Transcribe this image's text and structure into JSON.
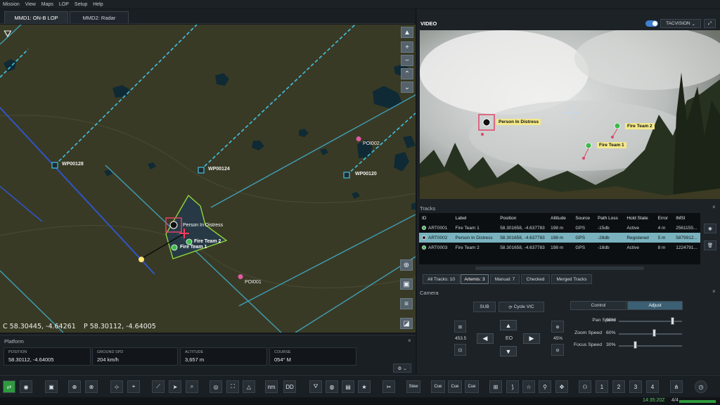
{
  "menu": [
    "Mission",
    "View",
    "Maps",
    "LOP",
    "Setup",
    "Help"
  ],
  "tabs": [
    {
      "label": "MMD1: ON-B LOP",
      "active": true
    },
    {
      "label": "MMD2: Radar",
      "active": false
    }
  ],
  "map": {
    "waypoints": [
      "WP00128",
      "WP00124",
      "WP00120"
    ],
    "pois": [
      "POI002",
      "POI001"
    ],
    "targets": [
      "Person In Distress",
      "Fire Team 2",
      "Fire Team 1"
    ],
    "cursor_coord": "C 58.30445, -4.64261",
    "platform_coord": "P 58.30112, -4.64005"
  },
  "platform": {
    "title": "Platform",
    "fields": [
      {
        "label": "POSITION",
        "value": "58.30112, -4.64005"
      },
      {
        "label": "GROUND SPD",
        "value": "204 km/h"
      },
      {
        "label": "ALTITUDE",
        "value": "3,657 m"
      },
      {
        "label": "COURSE",
        "value": "054° M"
      }
    ]
  },
  "video": {
    "title": "VIDEO",
    "source": "TACVISION",
    "labels": {
      "pid": "Person In Distress",
      "ft2": "Fire Team 2",
      "ft1": "Fire Team 1"
    }
  },
  "tracks": {
    "title": "Tracks",
    "columns": [
      "ID",
      "Label",
      "Position",
      "Altitude",
      "Source",
      "Path Loss",
      "Hold State",
      "Error",
      "IMSI"
    ],
    "rows": [
      {
        "id": "ART0001",
        "label": "Fire Team 1",
        "position": "58.301658, -4.637783",
        "altitude": "198 m",
        "source": "GPS",
        "path_loss": "-15db",
        "hold": "Active",
        "error": "4 m",
        "imsi": "2561155...",
        "status": "green",
        "selected": false
      },
      {
        "id": "ART0002",
        "label": "Person In Distress",
        "position": "58.301658, -4.637783",
        "altitude": "198 m",
        "source": "GPS",
        "path_loss": "-28db",
        "hold": "Registered",
        "error": "5 m",
        "imsi": "5879912...",
        "status": "dark",
        "selected": true
      },
      {
        "id": "ART0003",
        "label": "Fire Team 2",
        "position": "58.301658, -4.637783",
        "altitude": "198 m",
        "source": "GPS",
        "path_loss": "-18db",
        "hold": "Active",
        "error": "8 m",
        "imsi": "1224791...",
        "status": "green",
        "selected": false
      }
    ],
    "filters": [
      "All Tracks: 10",
      "Artemis: 3",
      "Manual: 7",
      "Checked",
      "Merged Tracks"
    ]
  },
  "camera": {
    "title": "Camera",
    "sub_label": "SUB",
    "cycle_label": "Cycle VIC",
    "modes": [
      "Control",
      "Adjust"
    ],
    "active_mode": "Adjust",
    "eo_label": "EO",
    "fov_value": "453.5",
    "zoom_pct": "45%",
    "sliders": [
      {
        "label": "Pan Speed",
        "value": "90%",
        "level": 0.9
      },
      {
        "label": "Zoom Speed",
        "value": "60%",
        "level": 0.6
      },
      {
        "label": "Focus Speed",
        "value": "30%",
        "level": 0.3
      }
    ]
  },
  "toolbar": {
    "text_buttons": [
      "nm",
      "DD",
      "Slew",
      "Cue",
      "Cue",
      "Cue"
    ],
    "numbers": [
      "1",
      "2",
      "3",
      "4"
    ]
  },
  "status": {
    "time": "14:35:20Z",
    "count": "4/4"
  },
  "colors": {
    "map_bg": "#393a25",
    "water": "#0f2a35",
    "track_blue": "#2b4fbf",
    "track_cyan": "#3fb8d3",
    "selected_row": "#7ab3bf",
    "tag_yellow": "#f4e98a",
    "green": "#3dbb4a"
  }
}
